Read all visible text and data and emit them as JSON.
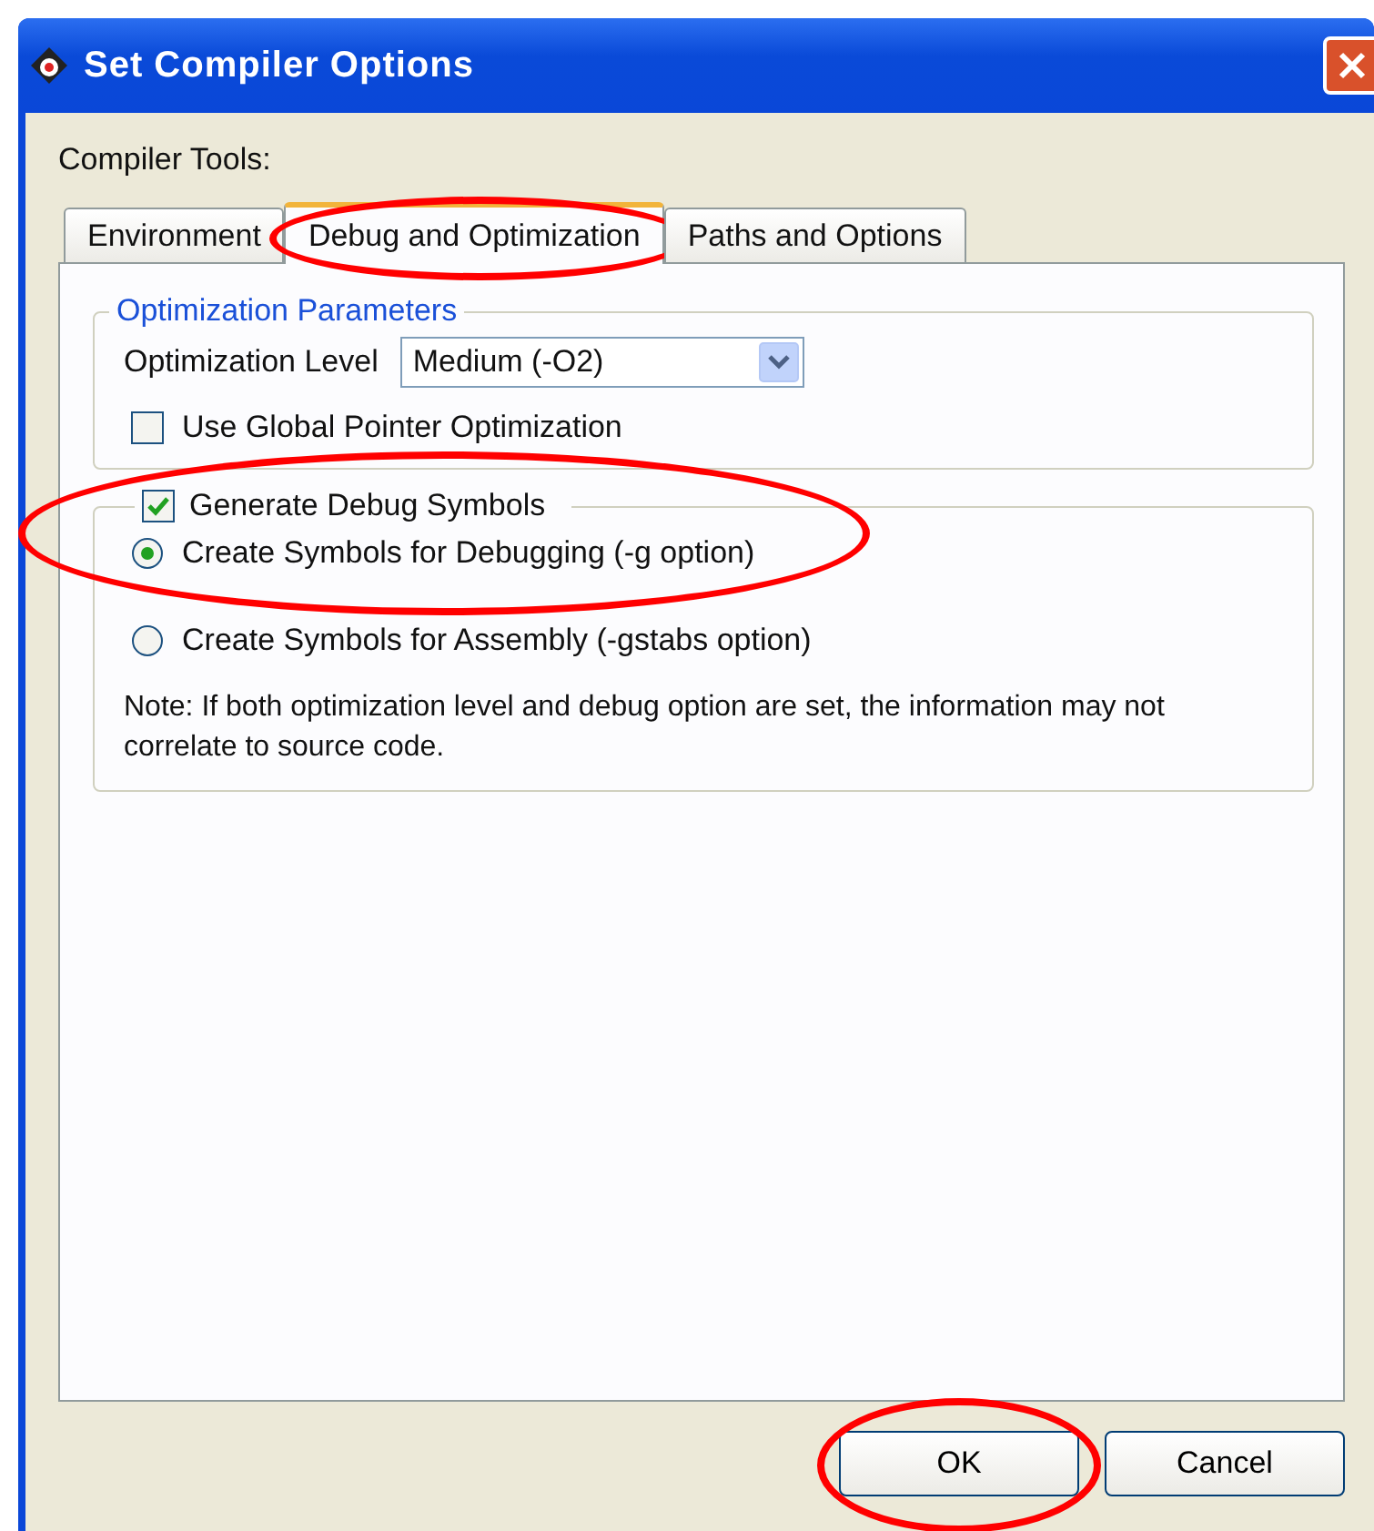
{
  "window": {
    "title": "Set Compiler Options"
  },
  "compiler_tools_label": "Compiler Tools:",
  "tabs": [
    {
      "label": "Environment",
      "selected": false,
      "highlighted": false
    },
    {
      "label": "Debug and Optimization",
      "selected": true,
      "highlighted": true
    },
    {
      "label": "Paths and Options",
      "selected": false,
      "highlighted": false
    }
  ],
  "optimization_parameters": {
    "legend": "Optimization Parameters",
    "level_label": "Optimization Level",
    "level_value": "Medium (-O2)",
    "global_pointer": {
      "label": "Use Global Pointer Optimization",
      "checked": false
    }
  },
  "debug_symbols": {
    "label": "Generate Debug Symbols",
    "checked": true,
    "highlighted": true,
    "options": [
      {
        "label": "Create Symbols for Debugging (-g option)",
        "selected": true
      },
      {
        "label": "Create Symbols for Assembly (-gstabs option)",
        "selected": false
      }
    ],
    "note": "Note: If both optimization level and debug option are set, the information may not correlate to source code."
  },
  "buttons": [
    {
      "label": "OK",
      "highlighted": true
    },
    {
      "label": "Cancel",
      "highlighted": false
    }
  ]
}
